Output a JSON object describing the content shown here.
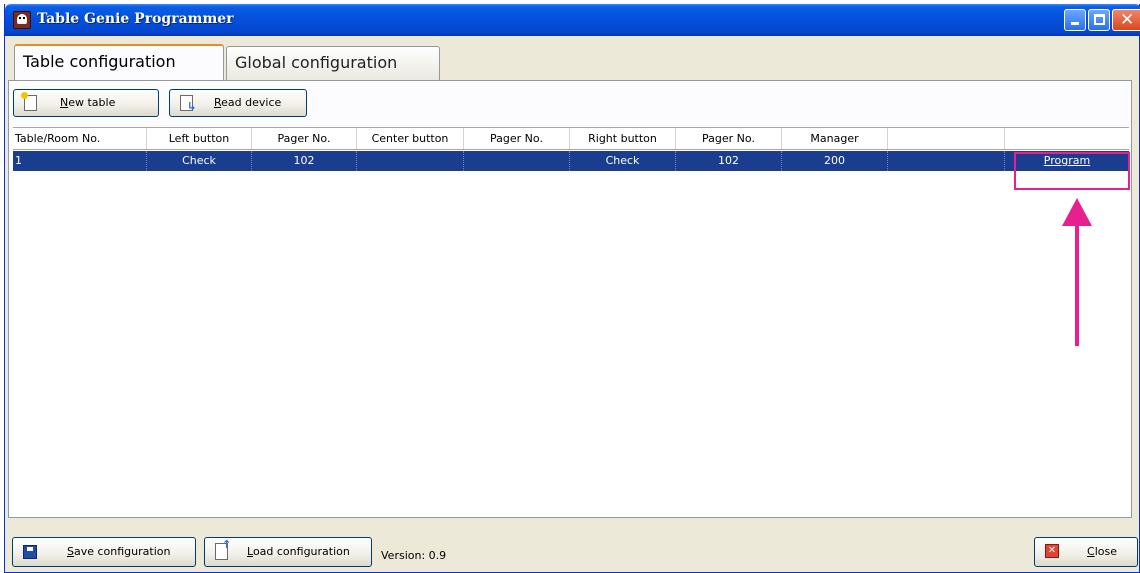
{
  "window": {
    "title": "Table Genie Programmer",
    "controls": {
      "minimize": "_",
      "maximize": "□",
      "close": "✕"
    }
  },
  "tabs": [
    {
      "label": "Table configuration",
      "active": true
    },
    {
      "label": "Global configuration",
      "active": false
    }
  ],
  "toolbar": {
    "new_table": {
      "prefix": "",
      "accel": "N",
      "rest": "ew table"
    },
    "read_device": {
      "prefix": "",
      "accel": "R",
      "rest": "ead device"
    }
  },
  "grid": {
    "columns": [
      "Table/Room No.",
      "Left button",
      "Pager No.",
      "Center button",
      "Pager No.",
      "Right button",
      "Pager No.",
      "Manager",
      "",
      ""
    ],
    "rows": [
      {
        "table_no": "1",
        "left_button": "Check",
        "left_pager": "102",
        "center_button": "",
        "center_pager": "",
        "right_button": "Check",
        "right_pager": "102",
        "manager": "200",
        "extra": "",
        "action": "Program"
      }
    ]
  },
  "bottom": {
    "save": {
      "prefix": "",
      "accel": "S",
      "rest": "ave configuration"
    },
    "load": {
      "prefix": "",
      "accel": "L",
      "rest": "oad configuration"
    },
    "close": {
      "prefix": "",
      "accel": "C",
      "rest": "lose"
    },
    "version_label": "Version: 0.9"
  },
  "colors": {
    "selection": "#1a3d8f",
    "annotation": "#e81f8e",
    "titlebar": "#0552dc"
  }
}
